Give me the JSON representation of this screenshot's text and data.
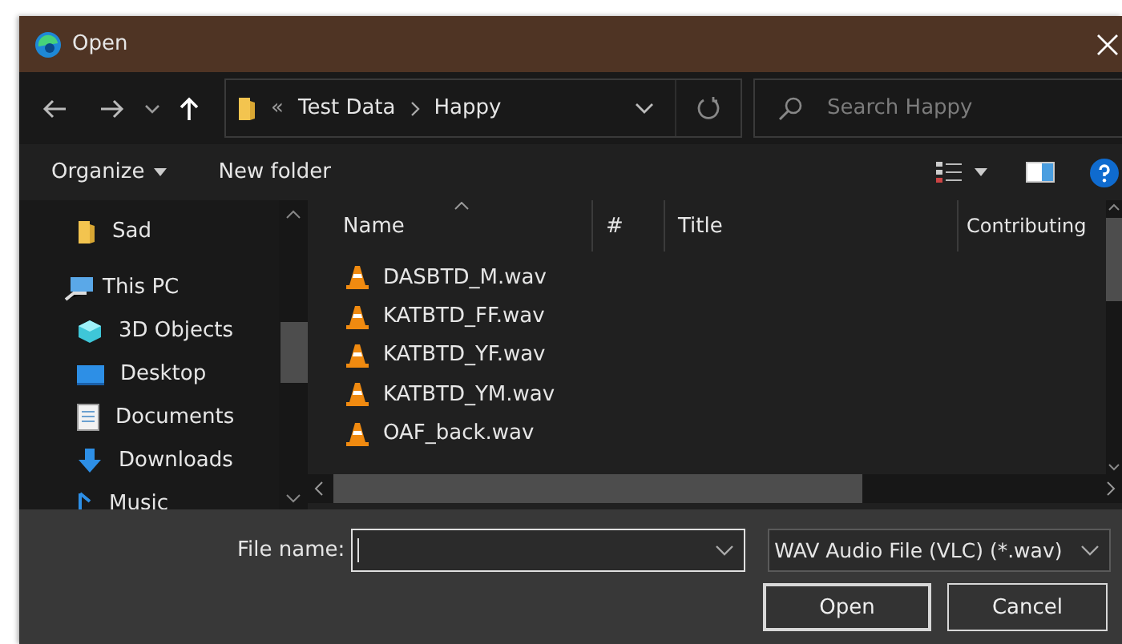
{
  "window": {
    "title": "Open"
  },
  "address": {
    "overflow": "«",
    "path": [
      "Test Data",
      "Happy"
    ]
  },
  "search": {
    "placeholder": "Search Happy"
  },
  "toolbar": {
    "organize": "Organize",
    "new_folder": "New folder"
  },
  "sidebar": {
    "items": [
      {
        "label": "Sad",
        "kind": "folder"
      },
      {
        "label": "This PC",
        "kind": "pc",
        "children": [
          {
            "label": "3D Objects",
            "kind": "objects"
          },
          {
            "label": "Desktop",
            "kind": "desktop"
          },
          {
            "label": "Documents",
            "kind": "documents"
          },
          {
            "label": "Downloads",
            "kind": "downloads"
          },
          {
            "label": "Music",
            "kind": "music"
          }
        ]
      }
    ]
  },
  "table": {
    "columns": [
      {
        "label": "Name",
        "sorted": true
      },
      {
        "label": "#",
        "sorted": false
      },
      {
        "label": "Title",
        "sorted": false
      },
      {
        "label": "Contributing",
        "sorted": false
      }
    ],
    "rows": [
      {
        "name": "DASBTD_M.wav"
      },
      {
        "name": "KATBTD_FF.wav"
      },
      {
        "name": "KATBTD_YF.wav"
      },
      {
        "name": "KATBTD_YM.wav"
      },
      {
        "name": "OAF_back.wav"
      }
    ]
  },
  "footer": {
    "file_name_label": "File name:",
    "filter": "WAV Audio File (VLC) (*.wav)",
    "buttons": [
      "Open",
      "Cancel"
    ]
  }
}
